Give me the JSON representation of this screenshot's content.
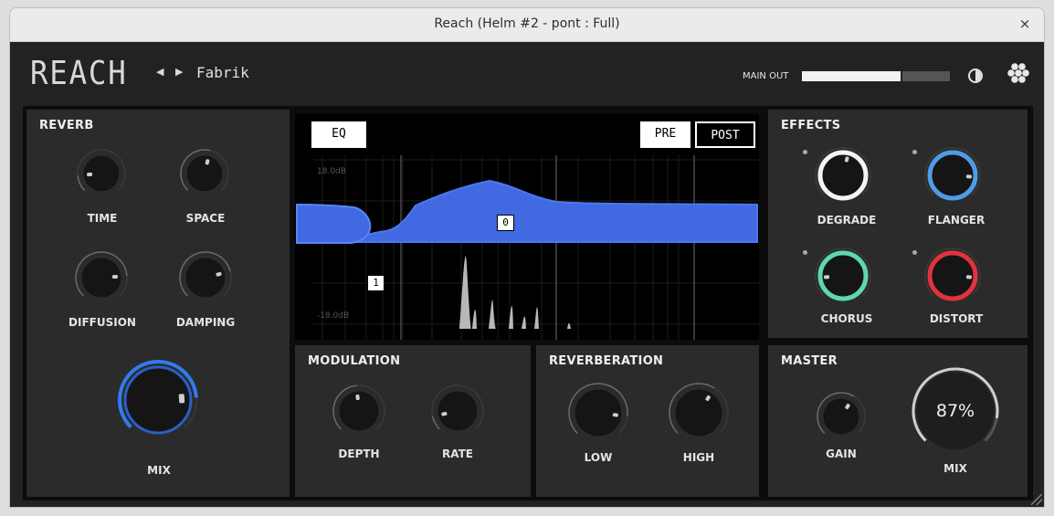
{
  "window": {
    "title": "Reach (Helm #2 - pont : Full)",
    "close": "×"
  },
  "header": {
    "logo": "REACH",
    "prev": "◀",
    "next": "▶",
    "preset": "Fabrik",
    "main_out_label": "MAIN OUT",
    "main_out_level": 0.68
  },
  "reverb": {
    "title": "REVERB",
    "knobs": [
      {
        "label": "TIME",
        "value": 0.15
      },
      {
        "label": "SPACE",
        "value": 0.55
      },
      {
        "label": "DIFFUSION",
        "value": 0.82
      },
      {
        "label": "DAMPING",
        "value": 0.78
      },
      {
        "label": "MIX",
        "value": 0.82
      }
    ]
  },
  "eq": {
    "mode_label": "EQ",
    "pre_label": "PRE",
    "post_label": "POST",
    "db_top": "18.0dB",
    "db_bottom": "-18.0dB",
    "points": [
      "0",
      "1"
    ]
  },
  "effects": {
    "title": "EFFECTS",
    "items": [
      {
        "label": "DEGRADE",
        "color": "#f4f4f4",
        "value": 0.55
      },
      {
        "label": "FLANGER",
        "color": "#4f9ce6",
        "value": 0.85
      },
      {
        "label": "CHORUS",
        "color": "#5fd6b3",
        "value": 0.15
      },
      {
        "label": "DISTORT",
        "color": "#e2323f",
        "value": 0.85
      }
    ]
  },
  "modulation": {
    "title": "MODULATION",
    "knobs": [
      {
        "label": "DEPTH",
        "value": 0.48
      },
      {
        "label": "RATE",
        "value": 0.12
      }
    ]
  },
  "reverberation": {
    "title": "REVERBERATION",
    "knobs": [
      {
        "label": "LOW",
        "value": 0.86
      },
      {
        "label": "HIGH",
        "value": 0.62
      }
    ]
  },
  "master": {
    "title": "MASTER",
    "gain_label": "GAIN",
    "gain_value": 0.62,
    "mix_label": "MIX",
    "mix_display": "87%",
    "mix_value": 0.87
  },
  "colors": {
    "accent_blue": "#2f7cf0",
    "eq_fill": "#4169e1"
  }
}
